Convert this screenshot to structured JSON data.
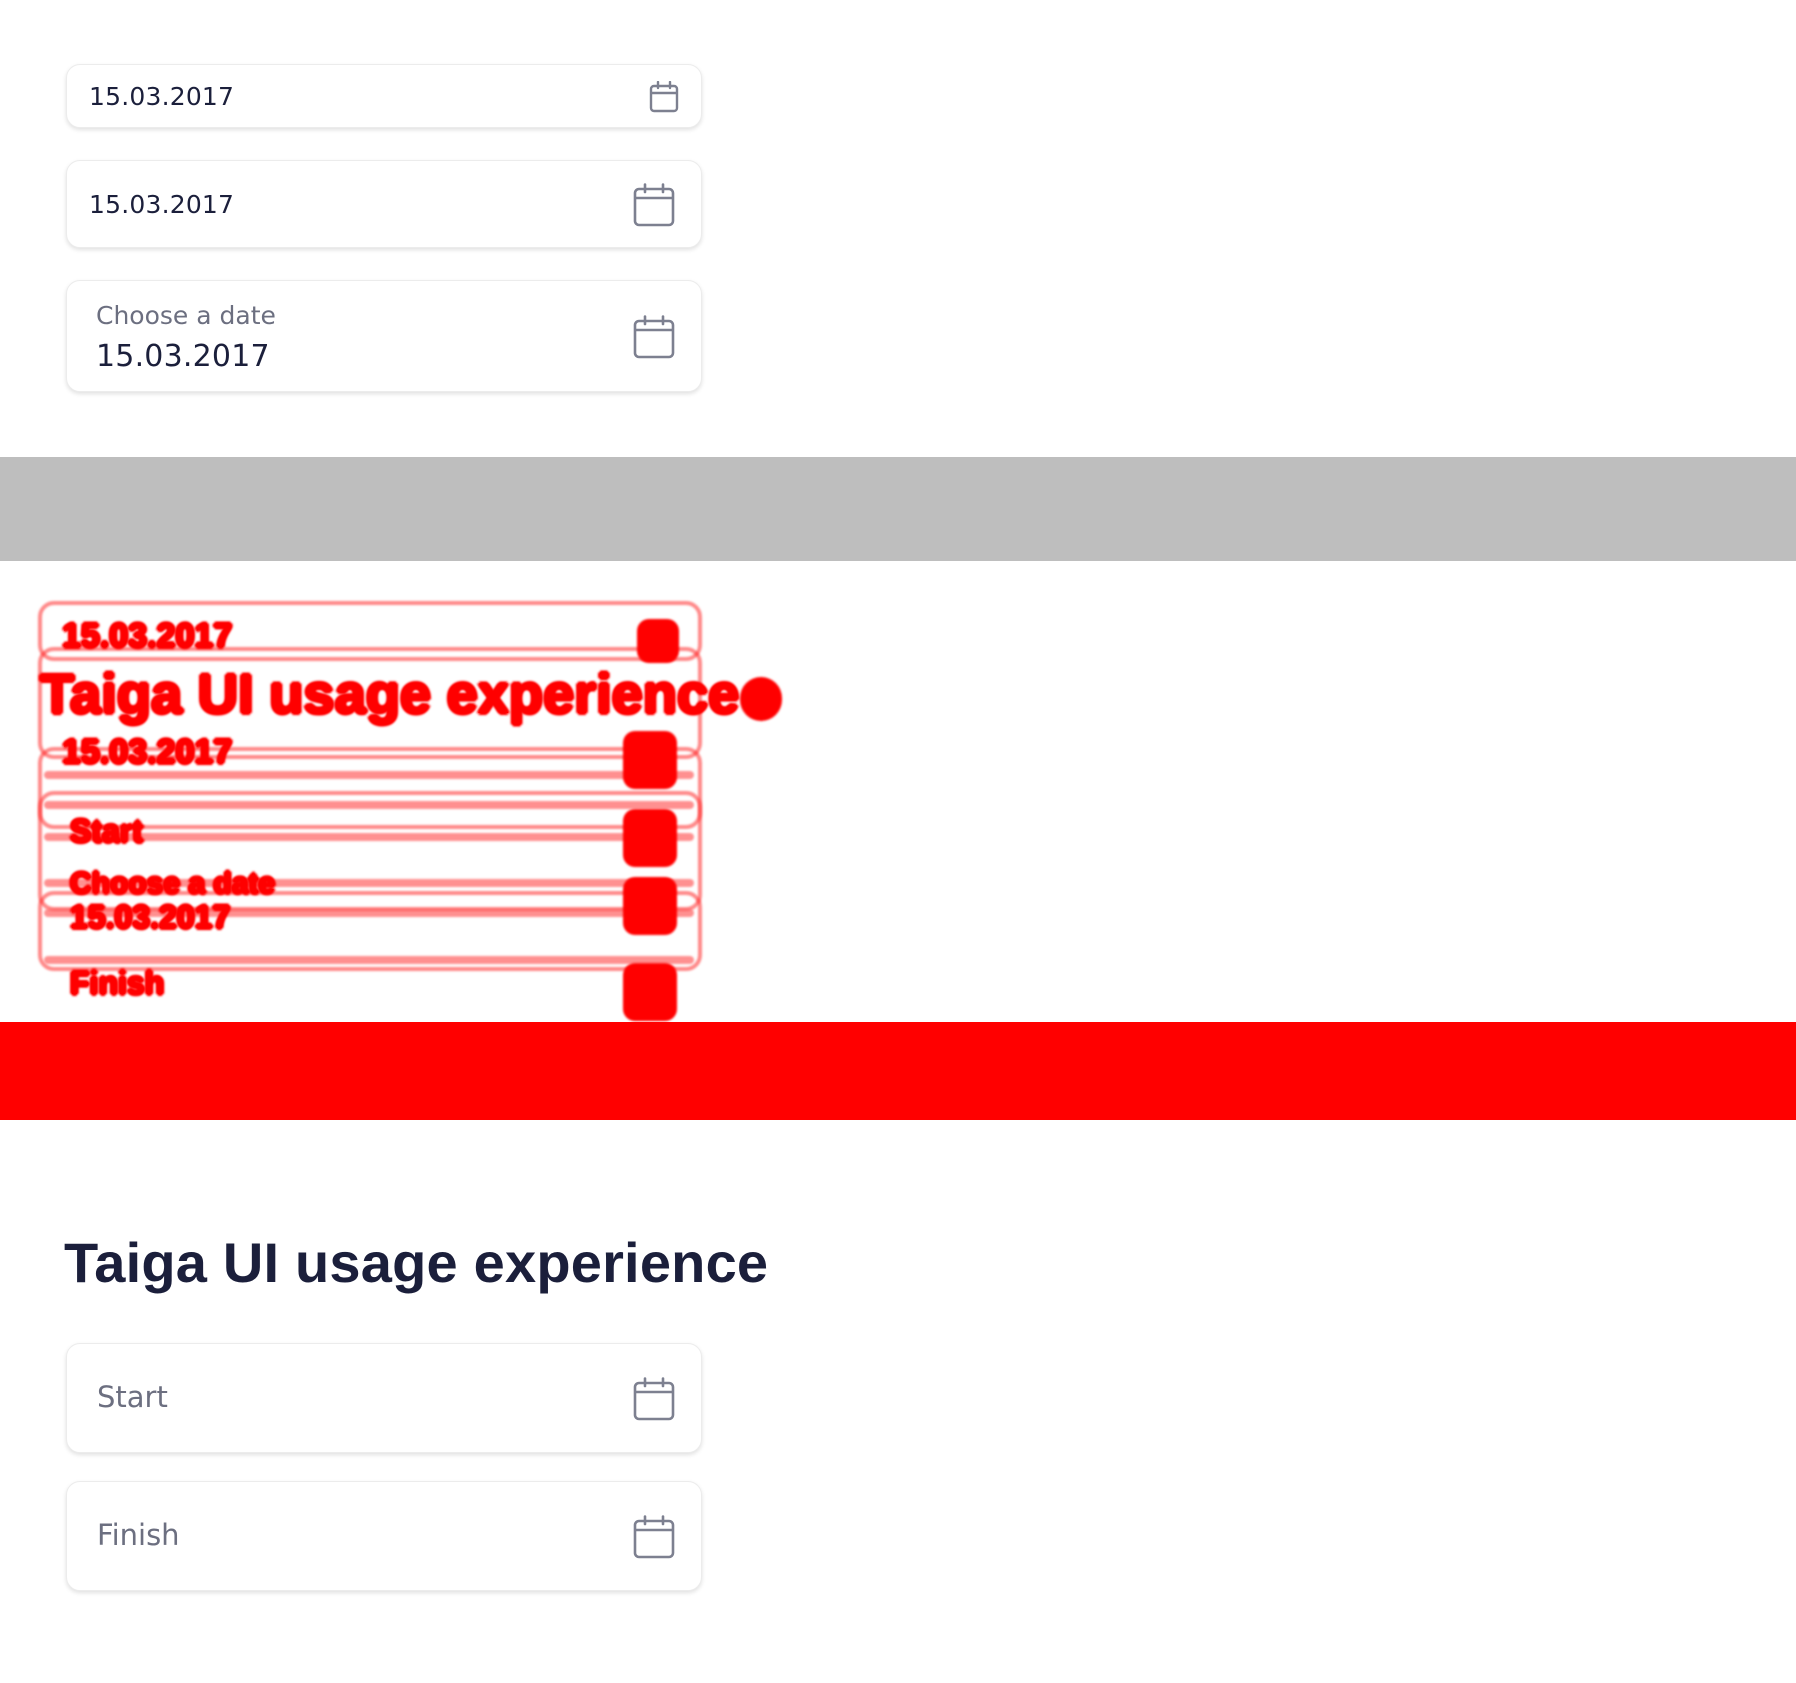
{
  "section1": {
    "inputs": [
      {
        "value": "15.03.2017",
        "icon": "calendar-icon"
      },
      {
        "value": "15.03.2017",
        "icon": "calendar-icon"
      },
      {
        "label": "Choose a date",
        "value": "15.03.2017",
        "icon": "calendar-icon"
      }
    ]
  },
  "section2": {
    "ghost_value_1": "15.03.2017",
    "ghost_title": "Taiga UI usage experience",
    "ghost_value_2": "15.03.2017",
    "ghost_start": "Start",
    "ghost_choose": "Choose a date",
    "ghost_value_3": "15.03.2017",
    "ghost_finish": "Finish",
    "highlight_color": "#ff0000"
  },
  "section3": {
    "title": "Taiga UI usage experience",
    "start_placeholder": "Start",
    "finish_placeholder": "Finish",
    "icon": "calendar-icon"
  },
  "colors": {
    "text": "#1b1f3b",
    "muted": "#6c6f80",
    "separator_gray": "#bebebe",
    "separator_red": "#ff0000"
  }
}
